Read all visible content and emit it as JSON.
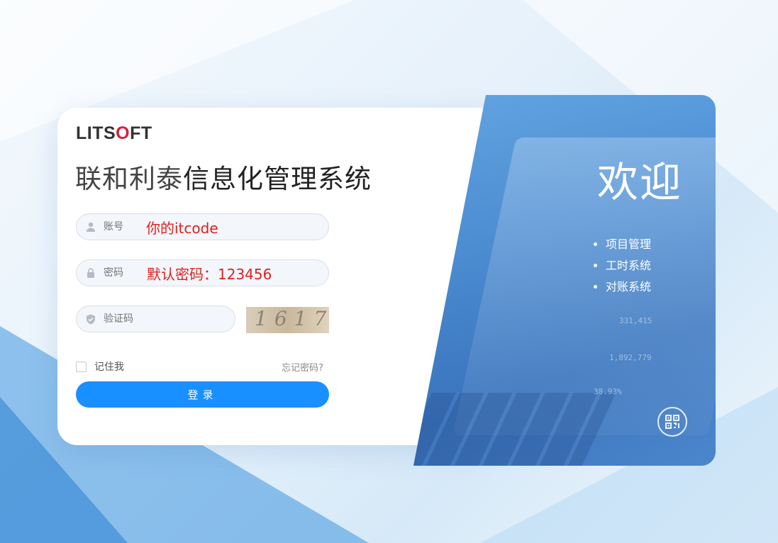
{
  "brand": {
    "logo_prefix": "LITS",
    "logo_o": "O",
    "logo_suffix": "FT"
  },
  "title": {
    "light": "联和利泰",
    "bold": "信息化管理系统"
  },
  "form": {
    "account_placeholder": "账号",
    "account_hint": "你的itcode",
    "password_placeholder": "密码",
    "password_hint": "默认密码：123456",
    "captcha_placeholder": "验证码",
    "captcha_text": "1617",
    "remember_label": "记住我",
    "forgot_label": "忘记密码?",
    "login_label": "登录"
  },
  "welcome_panel": {
    "heading": "欢迎",
    "features": [
      "项目管理",
      "工时系统",
      "对账系统"
    ],
    "deco_numbers": [
      "331,415",
      "1,892,779",
      "38.93%"
    ]
  },
  "colors": {
    "primary": "#1890ff",
    "hint": "#e02020",
    "logo_accent": "#d0243a",
    "panel": "#4a8fd6"
  },
  "icons": [
    "user-icon",
    "lock-icon",
    "shield-icon",
    "qr-code-icon"
  ]
}
